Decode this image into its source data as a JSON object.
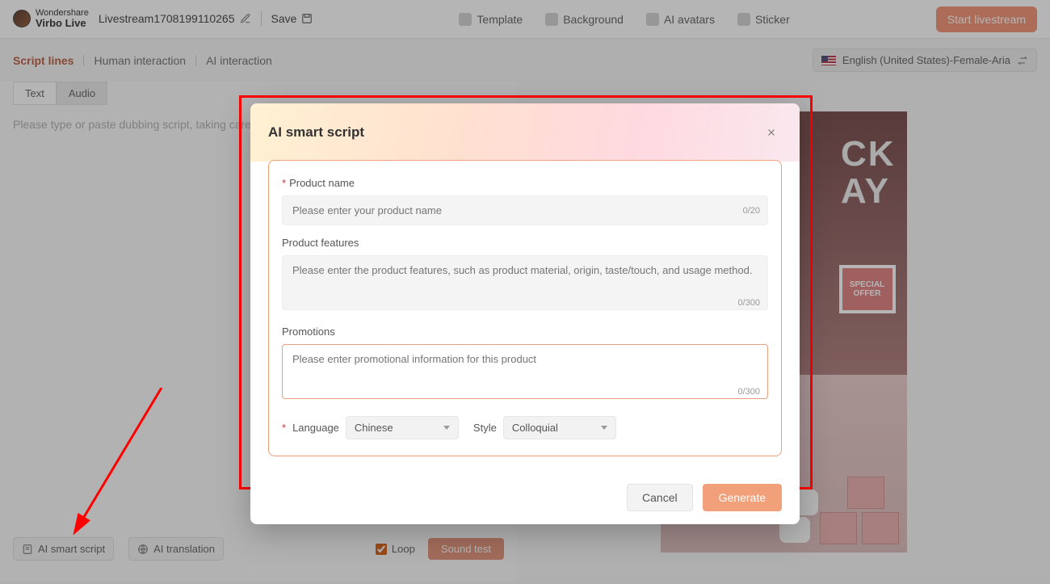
{
  "brand": {
    "line1": "Wondershare",
    "line2": "Virbo Live"
  },
  "project": {
    "name": "Livestream1708199110265"
  },
  "save_label": "Save",
  "topnav": {
    "template": "Template",
    "background": "Background",
    "avatars": "AI avatars",
    "sticker": "Sticker"
  },
  "start_button": "Start livestream",
  "subtabs": {
    "script_lines": "Script lines",
    "human_interaction": "Human interaction",
    "ai_interaction": "AI interaction"
  },
  "voice_selector": "English (United States)-Female-Aria",
  "text_tab": "Text",
  "audio_tab": "Audio",
  "editor_placeholder": "Please type or paste dubbing script, taking care to...",
  "footer": {
    "ai_smart_script": "AI smart script",
    "ai_translation": "AI translation",
    "loop": "Loop",
    "sound_test": "Sound test"
  },
  "preview": {
    "big_line1": "CK",
    "big_line2": "AY",
    "offer_l1": "SPECIAL",
    "offer_l2": "OFFER"
  },
  "modal": {
    "title": "AI smart script",
    "product_name_label": "Product name",
    "product_name_placeholder": "Please enter your product name",
    "product_name_counter": "0/20",
    "features_label": "Product features",
    "features_placeholder": "Please enter the product features, such as product material, origin, taste/touch, and usage method.",
    "features_counter": "0/300",
    "promotions_label": "Promotions",
    "promotions_placeholder": "Please enter promotional information for this product",
    "promotions_counter": "0/300",
    "language_label": "Language",
    "language_value": "Chinese",
    "style_label": "Style",
    "style_value": "Colloquial",
    "cancel": "Cancel",
    "generate": "Generate",
    "required_mark": "*"
  }
}
